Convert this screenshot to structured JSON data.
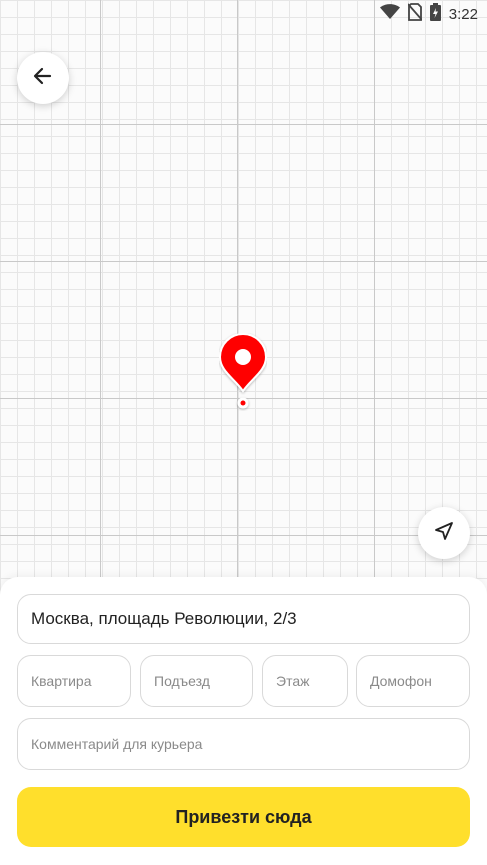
{
  "status_bar": {
    "time": "3:22",
    "icons": [
      "wifi-icon",
      "no-sim-icon",
      "battery-charging-icon"
    ]
  },
  "map": {
    "back_icon": "arrow-left-icon",
    "locate_icon": "navigation-arrow-icon",
    "pin_icon": "location-pin-icon",
    "pin_color": "#ff0000"
  },
  "form": {
    "address_value": "Москва, площадь Революции, 2/3",
    "apartment_placeholder": "Квартира",
    "entrance_placeholder": "Подъезд",
    "floor_placeholder": "Этаж",
    "intercom_placeholder": "Домофон",
    "comment_placeholder": "Комментарий для курьера",
    "submit_label": "Привезти сюда"
  },
  "colors": {
    "accent": "#ffdf2c",
    "pin": "#ff0000"
  }
}
